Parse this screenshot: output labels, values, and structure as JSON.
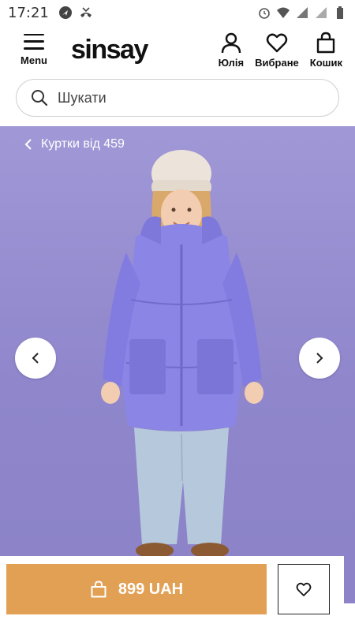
{
  "status": {
    "time": "17:21"
  },
  "header": {
    "menu_label": "Menu",
    "logo": "sinsay",
    "account_label": "Юлія",
    "favorites_label": "Вибране",
    "cart_label": "Кошик"
  },
  "search": {
    "placeholder": "Шукати"
  },
  "hero": {
    "breadcrumb": "Куртки від 459"
  },
  "bottom": {
    "price_label": "899 UAH"
  },
  "colors": {
    "accent": "#e2a055",
    "hero_bg": "#9a91d2",
    "jacket": "#8b85e6"
  }
}
